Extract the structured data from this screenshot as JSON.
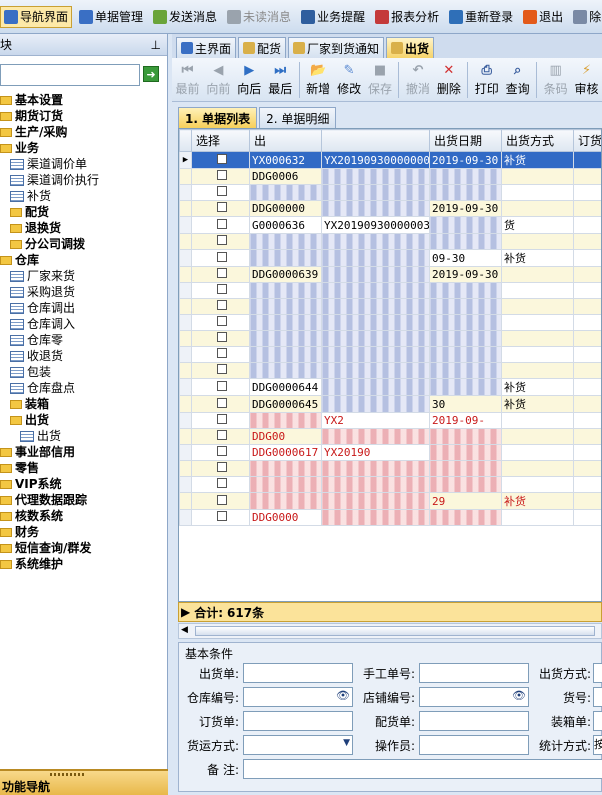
{
  "topbar": {
    "items": [
      {
        "label": "导航界面",
        "active": true
      },
      {
        "label": "单据管理"
      },
      {
        "label": "发送消息"
      },
      {
        "label": "未读消息",
        "disabled": true
      },
      {
        "label": "业务提醒"
      },
      {
        "label": "报表分析"
      },
      {
        "label": "重新登录"
      },
      {
        "label": "退出"
      },
      {
        "label": "除"
      }
    ]
  },
  "left_pane": {
    "title": "块",
    "pin": "中",
    "go_icon": "arrow-right",
    "tree": [
      {
        "label": "基本设置",
        "type": "folder",
        "level": 0,
        "bold": true
      },
      {
        "label": "期货订货",
        "type": "folder",
        "level": 0,
        "bold": true
      },
      {
        "label": "生产/采购",
        "type": "folder",
        "level": 0,
        "bold": true
      },
      {
        "label": "业务",
        "type": "folder",
        "level": 0,
        "bold": true
      },
      {
        "label": "渠道调价单",
        "type": "doc",
        "level": 1
      },
      {
        "label": "渠道调价执行",
        "type": "doc",
        "level": 1
      },
      {
        "label": "补货",
        "type": "doc",
        "level": 1
      },
      {
        "label": "配货",
        "type": "folder",
        "level": 1,
        "bold": true
      },
      {
        "label": "退换货",
        "type": "folder",
        "level": 1,
        "bold": true
      },
      {
        "label": "分公司调拨",
        "type": "folder",
        "level": 1,
        "bold": true
      },
      {
        "label": "仓库",
        "type": "folder",
        "level": 0,
        "bold": true
      },
      {
        "label": "厂家来货",
        "type": "doc",
        "level": 1
      },
      {
        "label": "采购退货",
        "type": "doc",
        "level": 1
      },
      {
        "label": "仓库调出",
        "type": "doc",
        "level": 1
      },
      {
        "label": "仓库调入",
        "type": "doc",
        "level": 1
      },
      {
        "label": "仓库零",
        "type": "doc",
        "level": 1
      },
      {
        "label": "收退货",
        "type": "doc",
        "level": 1
      },
      {
        "label": "包装",
        "type": "doc",
        "level": 1
      },
      {
        "label": "仓库盘点",
        "type": "doc",
        "level": 1
      },
      {
        "label": "装箱",
        "type": "folder",
        "level": 1,
        "bold": true
      },
      {
        "label": "出货",
        "type": "folder",
        "level": 1,
        "bold": true
      },
      {
        "label": "出货",
        "type": "doc",
        "level": 2
      },
      {
        "label": "事业部信用",
        "type": "folder",
        "level": 0,
        "bold": true
      },
      {
        "label": "零售",
        "type": "folder",
        "level": 0,
        "bold": true
      },
      {
        "label": "VIP系统",
        "type": "folder",
        "level": 0,
        "bold": true
      },
      {
        "label": "代理数据跟踪",
        "type": "folder",
        "level": 0,
        "bold": true
      },
      {
        "label": "核数系统",
        "type": "folder",
        "level": 0,
        "bold": true
      },
      {
        "label": "财务",
        "type": "folder",
        "level": 0,
        "bold": true
      },
      {
        "label": "短信查询/群发",
        "type": "folder",
        "level": 0,
        "bold": true
      },
      {
        "label": "系统维护",
        "type": "folder",
        "level": 0,
        "bold": true
      }
    ],
    "footer_label": "功能导航"
  },
  "tabs": [
    {
      "label": "主界面"
    },
    {
      "label": "配货"
    },
    {
      "label": "厂家到货通知"
    },
    {
      "label": "出货",
      "active": true
    }
  ],
  "toolbar": {
    "buttons": [
      {
        "label": "最前",
        "glyph": "⏮",
        "disabled": true
      },
      {
        "label": "向前",
        "glyph": "◀",
        "disabled": true
      },
      {
        "label": "向后",
        "glyph": "▶"
      },
      {
        "label": "最后",
        "glyph": "⏭"
      },
      {
        "sep": true
      },
      {
        "label": "新增",
        "glyph": "📂"
      },
      {
        "label": "修改",
        "glyph": "✎"
      },
      {
        "label": "保存",
        "glyph": "■",
        "disabled": true
      },
      {
        "sep": true
      },
      {
        "label": "撤消",
        "glyph": "↶",
        "disabled": true
      },
      {
        "label": "删除",
        "glyph": "✕"
      },
      {
        "sep": true
      },
      {
        "label": "打印",
        "glyph": "⎙"
      },
      {
        "label": "查询",
        "glyph": "⌕"
      },
      {
        "sep": true
      },
      {
        "label": "条码",
        "glyph": "▥",
        "disabled": true
      },
      {
        "label": "审核",
        "glyph": "⚡"
      }
    ]
  },
  "subtabs": [
    {
      "label": "1. 单据列表",
      "active": true
    },
    {
      "label": "2. 单据明细"
    }
  ],
  "grid": {
    "columns": [
      "选择",
      "出",
      "",
      "出货日期",
      "出货方式",
      "订货"
    ],
    "rows": [
      {
        "selected": true,
        "c1": "YX000632",
        "c2": "YX20190930000000",
        "date": "2019-09-30",
        "mode": "补货"
      },
      {
        "alt": true,
        "c1": "DDG0006",
        "c2": "",
        "date": "",
        "mode": ""
      },
      {
        "c1": "",
        "c2": "",
        "date": "",
        "mode": ""
      },
      {
        "alt": true,
        "c1": "DDG00000",
        "c2": "",
        "date": "2019-09-30",
        "mode": ""
      },
      {
        "c1": "G0000636",
        "c2": "YX20190930000003",
        "date": "",
        "mode": "货"
      },
      {
        "alt": true,
        "c1": "",
        "c2": "",
        "date": "",
        "mode": ""
      },
      {
        "c1": "",
        "c2": "",
        "date": "09-30",
        "mode": "补货"
      },
      {
        "alt": true,
        "c1": "DDG0000639",
        "c2": "",
        "date": "2019-09-30",
        "mode": ""
      },
      {
        "c1": "",
        "c2": "",
        "date": "",
        "mode": ""
      },
      {
        "alt": true,
        "c1": "",
        "c2": "",
        "date": "",
        "mode": ""
      },
      {
        "c1": "",
        "c2": "",
        "date": "",
        "mode": ""
      },
      {
        "alt": true,
        "c1": "",
        "c2": "",
        "date": "",
        "mode": ""
      },
      {
        "c1": "",
        "c2": "",
        "date": "",
        "mode": ""
      },
      {
        "alt": true,
        "c1": "",
        "c2": "",
        "date": "",
        "mode": ""
      },
      {
        "c1": "DDG0000644",
        "c2": "",
        "date": "",
        "mode": "补货"
      },
      {
        "alt": true,
        "c1": "DDG0000645",
        "c2": "",
        "date": "30",
        "mode": "补货"
      },
      {
        "red": true,
        "c1": "",
        "c2": "YX2",
        "date": "2019-09-",
        "mode": ""
      },
      {
        "red": true,
        "alt": true,
        "c1": "DDG00",
        "c2": "",
        "date": "",
        "mode": ""
      },
      {
        "red": true,
        "c1": "DDG0000617",
        "c2": "YX20190",
        "date": "",
        "mode": ""
      },
      {
        "red": true,
        "alt": true,
        "c1": "",
        "c2": "",
        "date": "",
        "mode": ""
      },
      {
        "red": true,
        "c1": "",
        "c2": "",
        "date": "",
        "mode": ""
      },
      {
        "red": true,
        "alt": true,
        "c1": "",
        "c2": "",
        "date": "29",
        "mode": "补货"
      },
      {
        "red": true,
        "c1": "DDG0000",
        "c2": "",
        "date": "",
        "mode": ""
      }
    ]
  },
  "summary": {
    "label": "合计:",
    "value": "617条"
  },
  "conditions": {
    "legend": "基本条件",
    "fields": {
      "chuhuodan": "出货单:",
      "shougong": "手工单号:",
      "chuhuofangshi": "出货方式:",
      "cangku": "仓库编号:",
      "dianpu": "店铺编号:",
      "huohao": "货号:",
      "dinghuodan": "订货单:",
      "peihuodan": "配货单:",
      "zhuangxiangdan": "装箱单:",
      "huoyun": "货运方式:",
      "caozuoyuan": "操作员:",
      "tongji": "统计方式:",
      "tongji_value": "按",
      "beizhu": "备    注:"
    }
  }
}
